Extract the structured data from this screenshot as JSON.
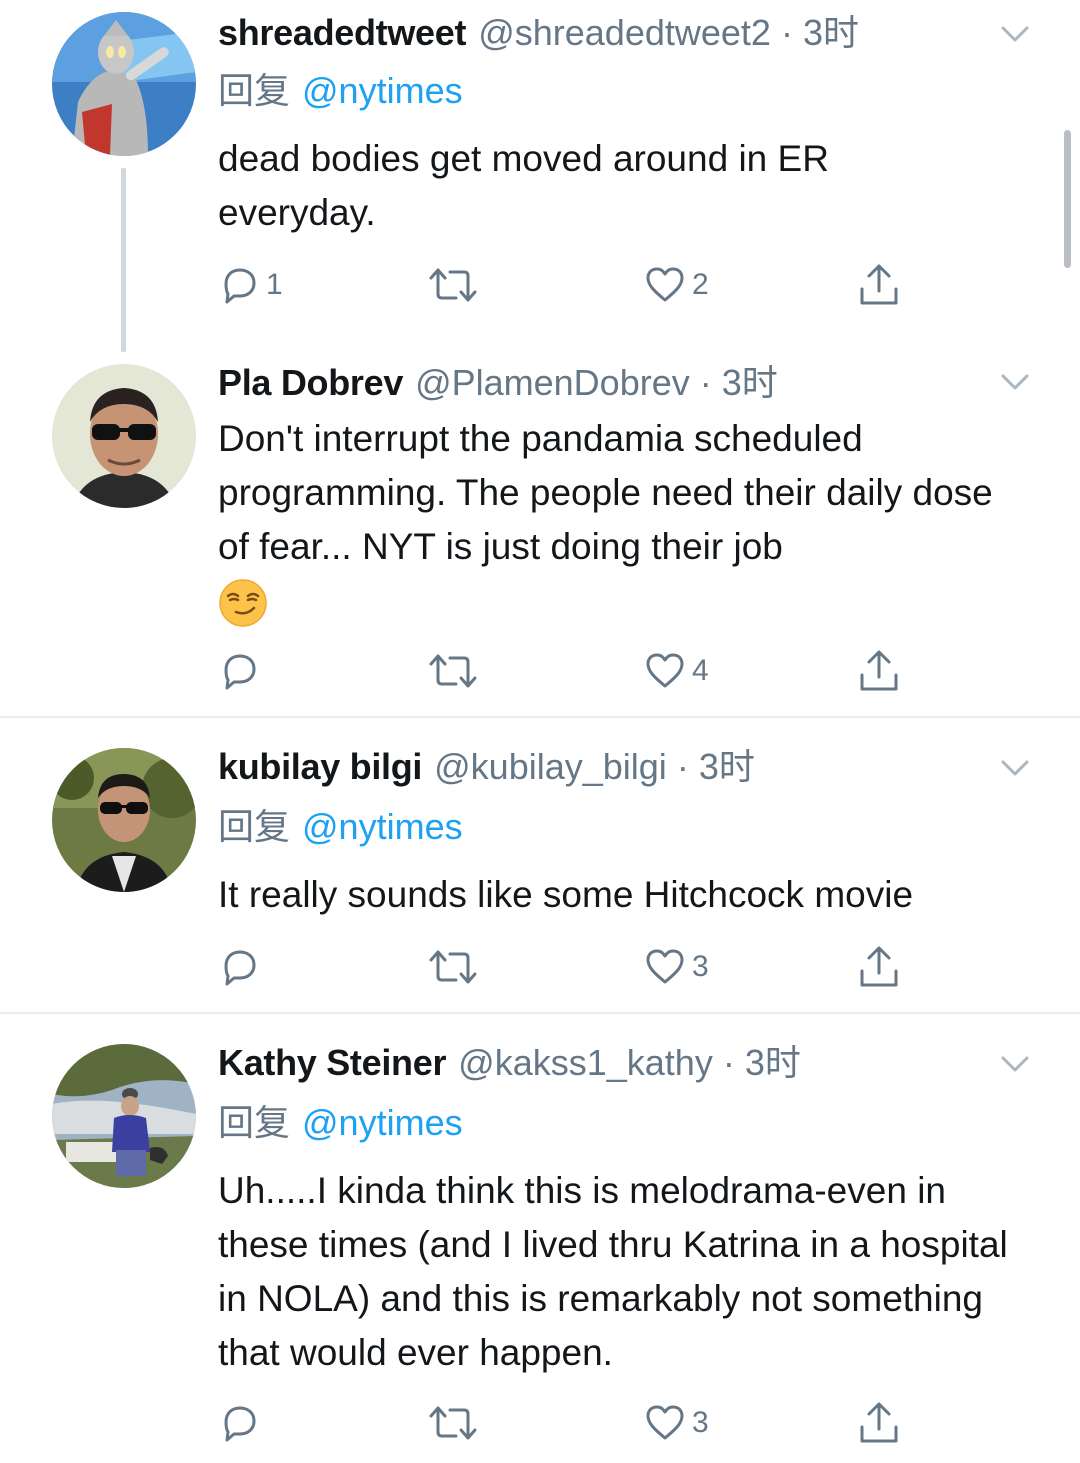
{
  "tweets": [
    {
      "name": "shreadedtweet",
      "handle": "@shreadedtweet2",
      "separator": "·",
      "time": "3时",
      "reply_prefix": "回复",
      "reply_target": "@nytimes",
      "text": "dead bodies get moved around in ER everyday.",
      "reply_count": "1",
      "retweet_count": "",
      "like_count": "2"
    },
    {
      "name": "Pla Dobrev",
      "handle": "@PlamenDobrev",
      "separator": "·",
      "time": "3时",
      "text": "Don't interrupt the pandamia scheduled programming. The people need their daily dose of fear... NYT is just doing their job",
      "emoji": "smirking-face",
      "reply_count": "",
      "retweet_count": "",
      "like_count": "4"
    },
    {
      "name": "kubilay bilgi",
      "handle": "@kubilay_bilgi",
      "separator": "·",
      "time": "3时",
      "reply_prefix": "回复",
      "reply_target": "@nytimes",
      "text": "It really sounds like some Hitchcock movie",
      "reply_count": "",
      "retweet_count": "",
      "like_count": "3"
    },
    {
      "name": "Kathy Steiner",
      "handle": "@kakss1_kathy",
      "separator": "·",
      "time": "3时",
      "reply_prefix": "回复",
      "reply_target": "@nytimes",
      "text": "Uh.....I kinda think this is melodrama-even in these times (and I lived thru Katrina in a hospital in NOLA) and this is remarkably not something that would ever happen.",
      "reply_count": "",
      "retweet_count": "",
      "like_count": "3"
    }
  ],
  "icons": {
    "reply": "reply-icon",
    "retweet": "retweet-icon",
    "like": "like-icon",
    "share": "share-icon",
    "more": "chevron-down-icon"
  },
  "colors": {
    "text": "#14171a",
    "secondary": "#657786",
    "link": "#1da1f2",
    "divider": "#e6ecf0",
    "thread_line": "#cfd9de"
  }
}
